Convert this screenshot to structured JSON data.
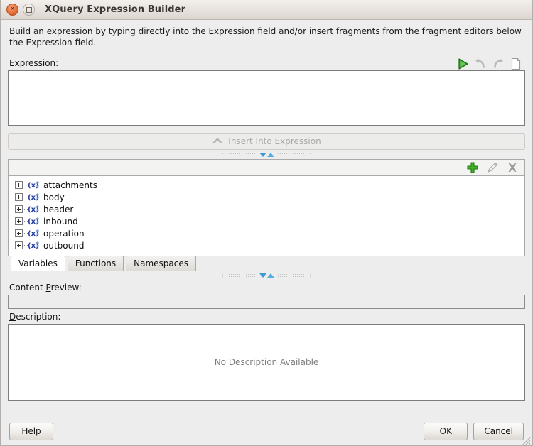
{
  "window": {
    "title": "XQuery Expression Builder",
    "close_icon": "close-icon",
    "maximize_icon": "maximize-icon"
  },
  "intro": {
    "text": "Build an expression by typing directly into the Expression field and/or insert fragments from the fragment editors below the Expression field."
  },
  "expression": {
    "label_prefix": "E",
    "label_rest": "xpression:",
    "value": "",
    "toolbar": [
      {
        "name": "run-icon",
        "title": "Run",
        "enabled": true
      },
      {
        "name": "undo-icon",
        "title": "Undo",
        "enabled": false
      },
      {
        "name": "redo-icon",
        "title": "Redo",
        "enabled": false
      },
      {
        "name": "new-document-icon",
        "title": "New",
        "enabled": false
      }
    ]
  },
  "insert_button": {
    "label": "Insert Into Expression",
    "icon": "chevron-up-icon",
    "enabled": false
  },
  "splitter_top": {
    "down_icon": "triangle-down-icon",
    "up_icon": "triangle-up-icon"
  },
  "splitter_bottom": {
    "down_icon": "triangle-down-icon",
    "up_icon": "triangle-up-icon"
  },
  "tree_toolbar": [
    {
      "name": "add-icon",
      "title": "Add",
      "enabled": true
    },
    {
      "name": "edit-pencil-icon",
      "title": "Edit",
      "enabled": false
    },
    {
      "name": "delete-icon",
      "title": "Delete",
      "enabled": false
    }
  ],
  "tree": {
    "items": [
      {
        "label": "attachments",
        "icon": "variable-icon",
        "expanded": false
      },
      {
        "label": "body",
        "icon": "variable-icon",
        "expanded": false
      },
      {
        "label": "header",
        "icon": "variable-icon",
        "expanded": false
      },
      {
        "label": "inbound",
        "icon": "variable-icon",
        "expanded": false
      },
      {
        "label": "operation",
        "icon": "variable-icon",
        "expanded": false
      },
      {
        "label": "outbound",
        "icon": "variable-icon",
        "expanded": false
      }
    ]
  },
  "tabs": [
    {
      "label": "Variables",
      "active": true
    },
    {
      "label": "Functions",
      "active": false
    },
    {
      "label": "Namespaces",
      "active": false
    }
  ],
  "content_preview": {
    "label_a": "Content ",
    "label_mnemonic": "P",
    "label_b": "review:",
    "value": ""
  },
  "description": {
    "label_mnemonic": "D",
    "label_rest": "escription:",
    "placeholder": "No Description Available"
  },
  "footer": {
    "help_mnemonic": "H",
    "help_rest": "elp",
    "ok_label": "OK",
    "cancel_label": "Cancel",
    "grip_icon": "resize-grip-icon"
  },
  "colors": {
    "accent_green": "#3aa02c",
    "accent_blue": "#3d9ad6",
    "close_orange": "#e8703a",
    "window_bg": "#ededed",
    "field_bg": "#ffffff"
  }
}
